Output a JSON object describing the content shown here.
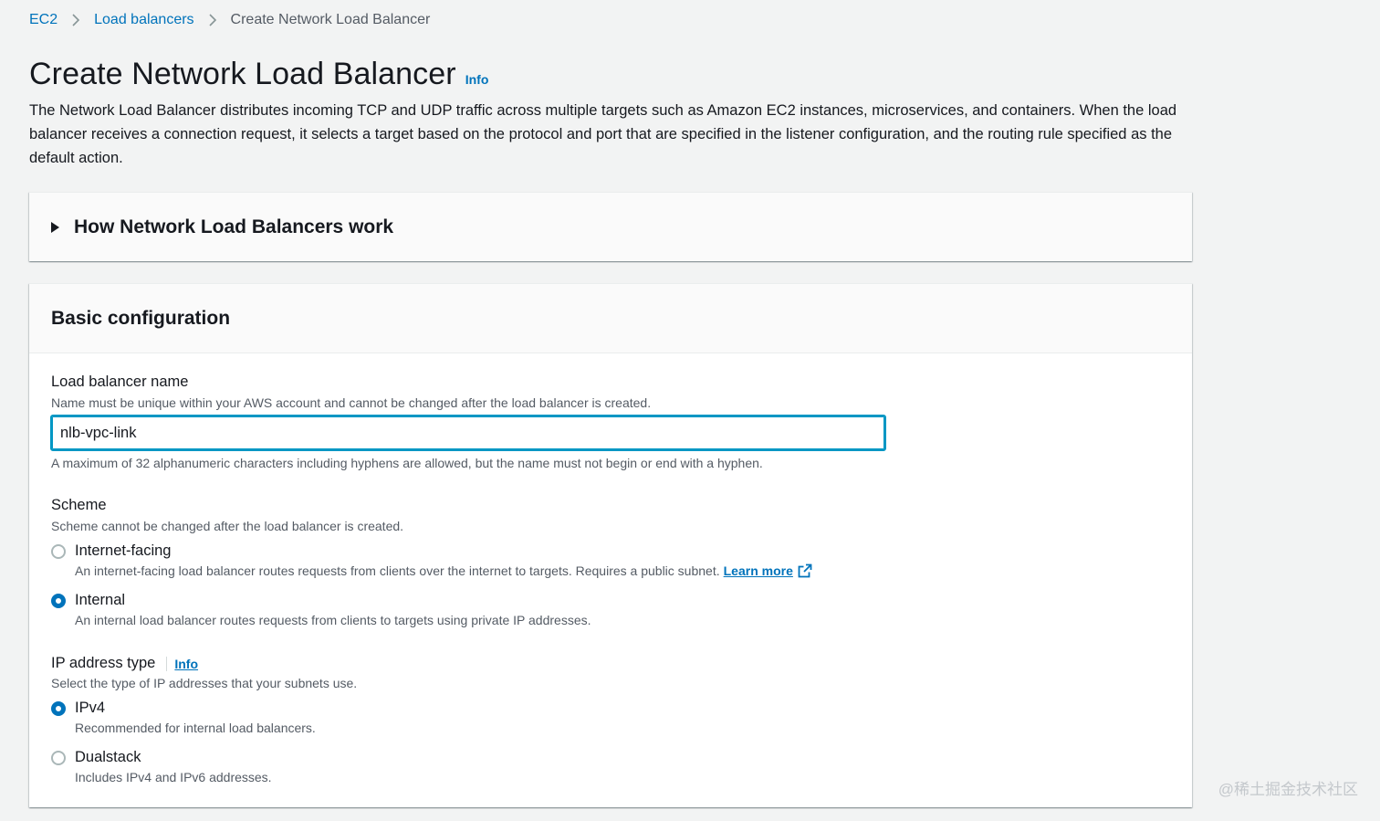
{
  "breadcrumb": {
    "items": [
      "EC2",
      "Load balancers"
    ],
    "current": "Create Network Load Balancer"
  },
  "header": {
    "title": "Create Network Load Balancer",
    "info": "Info",
    "description": "The Network Load Balancer distributes incoming TCP and UDP traffic across multiple targets such as Amazon EC2 instances, microservices, and containers. When the load balancer receives a connection request, it selects a target based on the protocol and port that are specified in the listener configuration, and the routing rule specified as the default action."
  },
  "expandable": {
    "title": "How Network Load Balancers work"
  },
  "basic_config": {
    "title": "Basic configuration",
    "name_field": {
      "label": "Load balancer name",
      "description": "Name must be unique within your AWS account and cannot be changed after the load balancer is created.",
      "value": "nlb-vpc-link",
      "constraint": "A maximum of 32 alphanumeric characters including hyphens are allowed, but the name must not begin or end with a hyphen."
    },
    "scheme": {
      "label": "Scheme",
      "description": "Scheme cannot be changed after the load balancer is created.",
      "options": [
        {
          "label": "Internet-facing",
          "description": "An internet-facing load balancer routes requests from clients over the internet to targets. Requires a public subnet.",
          "link": "Learn more",
          "checked": false
        },
        {
          "label": "Internal",
          "description": "An internal load balancer routes requests from clients to targets using private IP addresses.",
          "checked": true
        }
      ]
    },
    "ip_type": {
      "label": "IP address type",
      "info": "Info",
      "description": "Select the type of IP addresses that your subnets use.",
      "options": [
        {
          "label": "IPv4",
          "description": "Recommended for internal load balancers.",
          "checked": true
        },
        {
          "label": "Dualstack",
          "description": "Includes IPv4 and IPv6 addresses.",
          "checked": false
        }
      ]
    }
  },
  "watermark": "@稀土掘金技术社区",
  "colors": {
    "link": "#0073bb",
    "focus": "#0097c4",
    "background": "#f2f3f3"
  }
}
